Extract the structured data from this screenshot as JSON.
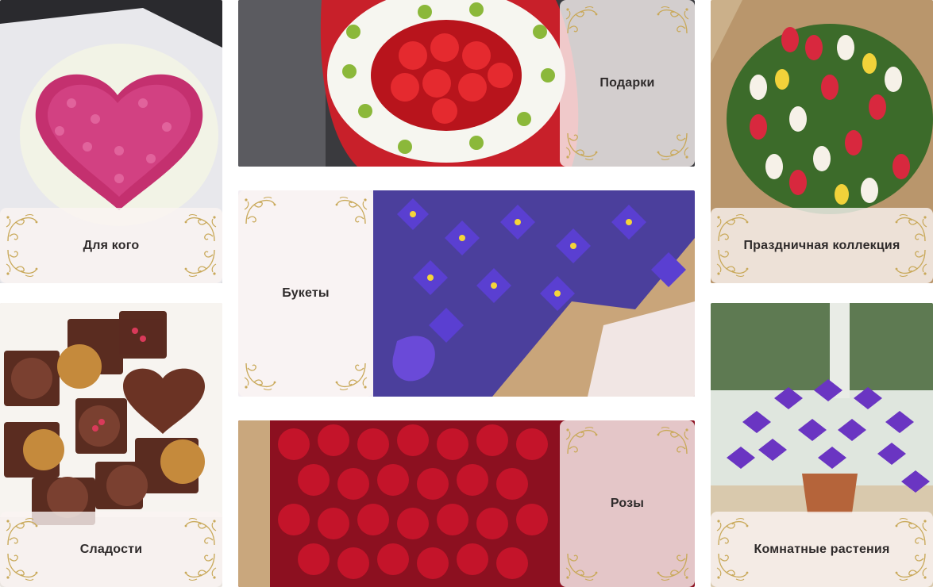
{
  "categories": {
    "for_whom": {
      "label": "Для кого",
      "image": "heart-rose-bouquet-image"
    },
    "gifts": {
      "label": "Подарки",
      "image": "strawberry-daisy-box-image"
    },
    "holiday_collection": {
      "label": "Праздничная коллекция",
      "image": "tulip-bouquet-image"
    },
    "bouquets": {
      "label": "Букеты",
      "image": "iris-bouquet-image"
    },
    "sweets": {
      "label": "Сладости",
      "image": "chocolate-box-image"
    },
    "roses": {
      "label": "Розы",
      "image": "red-roses-image"
    },
    "houseplants": {
      "label": "Комнатные растения",
      "image": "purple-oxalis-plant-image"
    }
  },
  "theme": {
    "panel_color": "#faf4f3",
    "ornament_color": "#c9a95a",
    "label_color": "#2f2b2b"
  },
  "ornament_icon": "gold-flourish-corner-icon"
}
